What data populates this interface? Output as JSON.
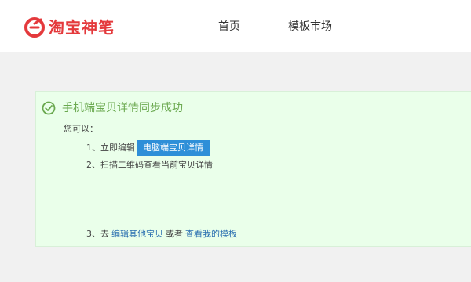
{
  "header": {
    "logo_text": "淘宝神笔",
    "brand_color": "#e4393c",
    "nav": {
      "home": "首页",
      "template_market": "模板市场"
    }
  },
  "panel": {
    "success_icon": "check-circle-icon",
    "success_color": "#6aa84f",
    "title": "手机端宝贝详情同步成功",
    "intro": "您可以：",
    "step1": {
      "prefix": "1、立即编辑",
      "button": "电脑端宝贝详情"
    },
    "step2": {
      "text": "2、扫描二维码查看当前宝贝详情"
    },
    "step3": {
      "prefix": "3、去",
      "link1": "编辑其他宝贝",
      "middle": "或者",
      "link2": "查看我的模板"
    }
  }
}
